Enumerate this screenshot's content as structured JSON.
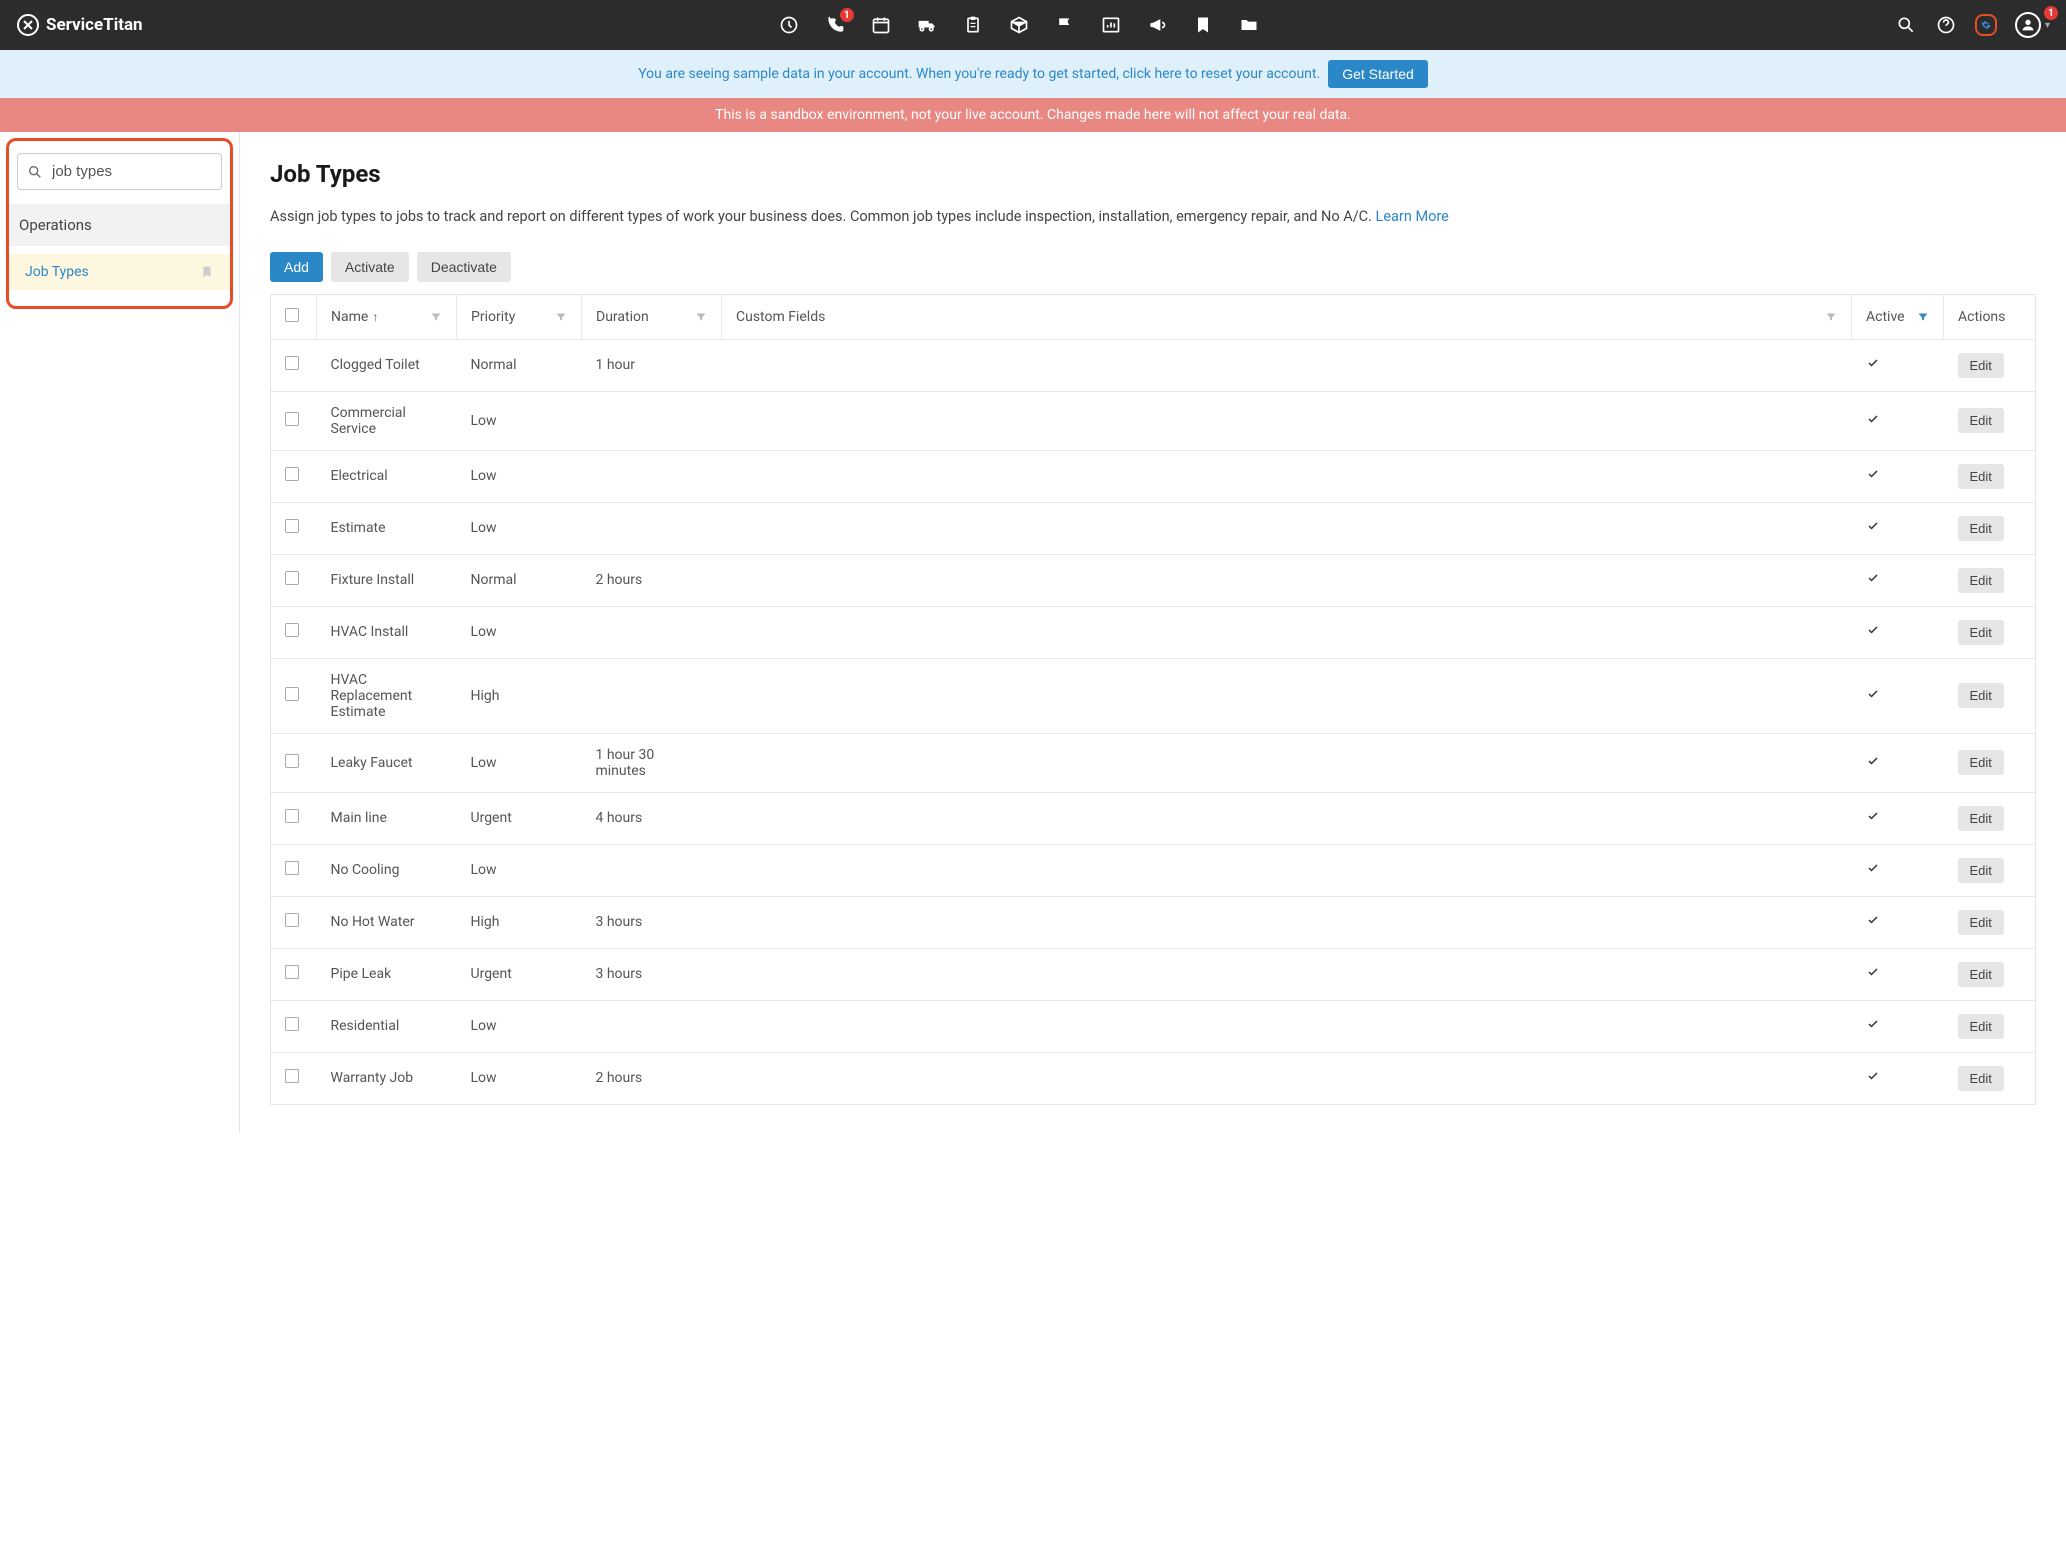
{
  "brand": "ServiceTitan",
  "nav_badges": {
    "phone": "1",
    "avatar": "1"
  },
  "info_banner": {
    "text": "You are seeing sample data in your account. When you're ready to get started, click here to reset your account.",
    "button": "Get Started"
  },
  "warn_banner": "This is a sandbox environment, not your live account. Changes made here will not affect your real data.",
  "sidebar": {
    "search_value": "job types",
    "section": "Operations",
    "item": "Job Types"
  },
  "page": {
    "title": "Job Types",
    "desc": "Assign job types to jobs to track and report on different types of work your business does. Common job types include inspection, installation, emergency repair, and No A/C. ",
    "learn_more": "Learn More"
  },
  "toolbar": {
    "add": "Add",
    "activate": "Activate",
    "deactivate": "Deactivate"
  },
  "columns": {
    "name": "Name",
    "priority": "Priority",
    "duration": "Duration",
    "custom": "Custom Fields",
    "active": "Active",
    "actions": "Actions"
  },
  "edit_label": "Edit",
  "rows": [
    {
      "name": "Clogged Toilet",
      "priority": "Normal",
      "duration": "1 hour",
      "active": true
    },
    {
      "name": "Commercial Service",
      "priority": "Low",
      "duration": "",
      "active": true
    },
    {
      "name": "Electrical",
      "priority": "Low",
      "duration": "",
      "active": true
    },
    {
      "name": "Estimate",
      "priority": "Low",
      "duration": "",
      "active": true
    },
    {
      "name": "Fixture Install",
      "priority": "Normal",
      "duration": "2 hours",
      "active": true
    },
    {
      "name": "HVAC Install",
      "priority": "Low",
      "duration": "",
      "active": true
    },
    {
      "name": "HVAC Replacement Estimate",
      "priority": "High",
      "duration": "",
      "active": true
    },
    {
      "name": "Leaky Faucet",
      "priority": "Low",
      "duration": "1 hour 30 minutes",
      "active": true
    },
    {
      "name": "Main line",
      "priority": "Urgent",
      "duration": "4 hours",
      "active": true
    },
    {
      "name": "No Cooling",
      "priority": "Low",
      "duration": "",
      "active": true
    },
    {
      "name": "No Hot Water",
      "priority": "High",
      "duration": "3 hours",
      "active": true
    },
    {
      "name": "Pipe Leak",
      "priority": "Urgent",
      "duration": "3 hours",
      "active": true
    },
    {
      "name": "Residential",
      "priority": "Low",
      "duration": "",
      "active": true
    },
    {
      "name": "Warranty Job",
      "priority": "Low",
      "duration": "2 hours",
      "active": true
    }
  ]
}
